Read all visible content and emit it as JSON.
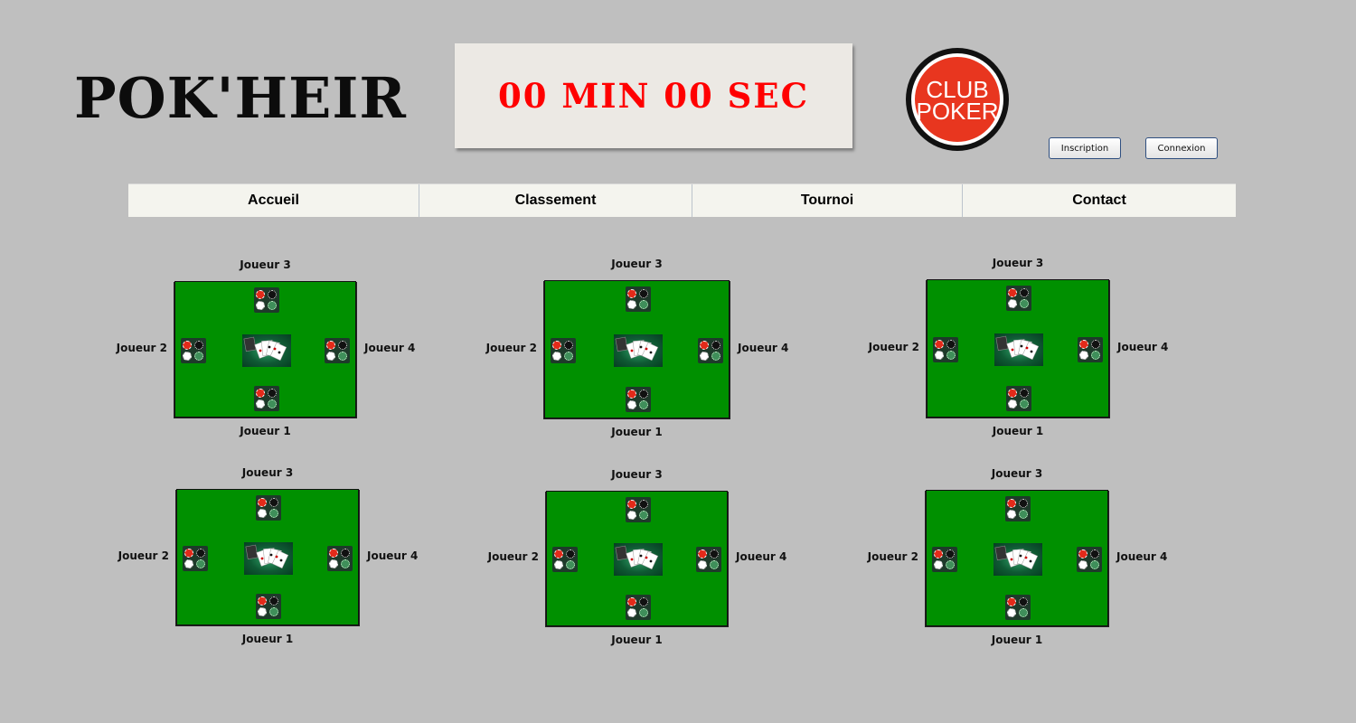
{
  "header": {
    "title": "POK'HEIR",
    "timer": "00 MIN 00 SEC",
    "club_logo": {
      "line1": "CLUB",
      "line2": "POKER",
      "color": "#e8361f"
    },
    "inscription_label": "Inscription",
    "connexion_label": "Connexion"
  },
  "nav": {
    "items": [
      {
        "label": "Accueil"
      },
      {
        "label": "Classement"
      },
      {
        "label": "Tournoi"
      },
      {
        "label": "Contact"
      }
    ]
  },
  "tables": [
    {
      "seats": {
        "top": "Joueur 3",
        "left": "Joueur 2",
        "right": "Joueur 4",
        "bottom": "Joueur 1"
      }
    },
    {
      "seats": {
        "top": "Joueur 3",
        "left": "Joueur 2",
        "right": "Joueur 4",
        "bottom": "Joueur 1"
      }
    },
    {
      "seats": {
        "top": "Joueur 3",
        "left": "Joueur 2",
        "right": "Joueur 4",
        "bottom": "Joueur 1"
      }
    },
    {
      "seats": {
        "top": "Joueur 3",
        "left": "Joueur 2",
        "right": "Joueur 4",
        "bottom": "Joueur 1"
      }
    },
    {
      "seats": {
        "top": "Joueur 3",
        "left": "Joueur 2",
        "right": "Joueur 4",
        "bottom": "Joueur 1"
      }
    },
    {
      "seats": {
        "top": "Joueur 3",
        "left": "Joueur 2",
        "right": "Joueur 4",
        "bottom": "Joueur 1"
      }
    }
  ],
  "colors": {
    "table_felt": "#009000",
    "timer_text": "#ff0000",
    "background": "#bfbfbf"
  },
  "icons": {
    "chips": "poker-chips-icon",
    "cards": "playing-cards-icon"
  }
}
